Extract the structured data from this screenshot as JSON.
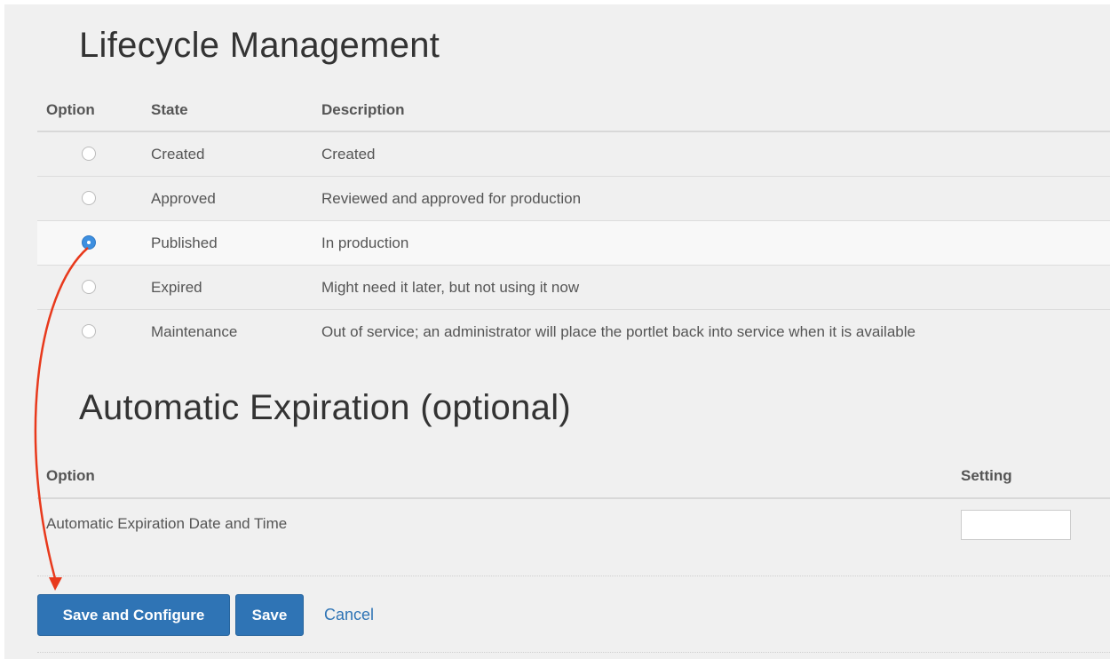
{
  "lifecycle": {
    "title": "Lifecycle Management",
    "headers": {
      "option": "Option",
      "state": "State",
      "description": "Description"
    },
    "rows": [
      {
        "state": "Created",
        "description": "Created",
        "selected": false
      },
      {
        "state": "Approved",
        "description": "Reviewed and approved for production",
        "selected": false
      },
      {
        "state": "Published",
        "description": "In production",
        "selected": true
      },
      {
        "state": "Expired",
        "description": "Might need it later, but not using it now",
        "selected": false
      },
      {
        "state": "Maintenance",
        "description": "Out of service; an administrator will place the portlet back into service when it is available",
        "selected": false
      }
    ]
  },
  "expiration": {
    "title": "Automatic Expiration (optional)",
    "headers": {
      "option": "Option",
      "setting": "Setting"
    },
    "row_label": "Automatic Expiration Date and Time",
    "value": ""
  },
  "actions": {
    "save_configure": "Save and Configure",
    "save": "Save",
    "cancel": "Cancel"
  },
  "colors": {
    "primary": "#2f74b5",
    "annotation_arrow": "#e8391c",
    "radio_checked": "#3d8fe0"
  }
}
